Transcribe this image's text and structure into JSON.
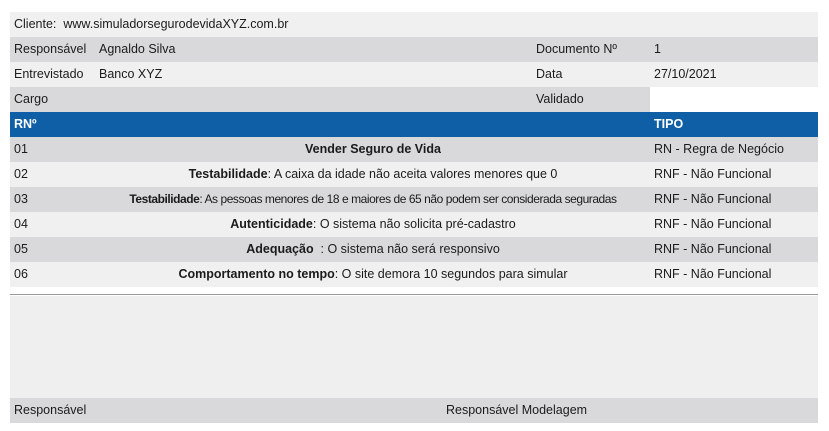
{
  "client": {
    "label": "Cliente:",
    "value": "www.simuladorsegurodevidaXYZ.com.br"
  },
  "info": [
    {
      "l1": "Responsável",
      "v1": "Agnaldo Silva",
      "l2": "Documento Nº",
      "v2": "1"
    },
    {
      "l1": "Entrevistado",
      "v1": "Banco XYZ",
      "l2": "Data",
      "v2": "27/10/2021"
    },
    {
      "l1": "Cargo",
      "v1": "",
      "l2": "Validado",
      "v2": ""
    }
  ],
  "header": {
    "rn": "RNº",
    "tipo": "TIPO"
  },
  "requirements": [
    {
      "rn": "01",
      "bold": "Vender Seguro de Vida",
      "text": "",
      "tipo": "RN - Regra de Negócio"
    },
    {
      "rn": "02",
      "bold": "Testabilidade",
      "text": ": A caixa da idade não aceita valores menores que 0",
      "tipo": "RNF - Não Funcional"
    },
    {
      "rn": "03",
      "bold": "Testabilidade",
      "text": ": As pessoas menores de 18 e maiores de 65 não podem ser considerada seguradas",
      "tipo": "RNF - Não Funcional"
    },
    {
      "rn": "04",
      "bold": "Autenticidade",
      "text": ": O sistema não solicita pré-cadastro",
      "tipo": "RNF - Não Funcional"
    },
    {
      "rn": "05",
      "bold": "Adequação",
      "text": "  : O sistema não será responsivo",
      "tipo": "RNF - Não Funcional"
    },
    {
      "rn": "06",
      "bold": "Comportamento no tempo",
      "text": ": O site demora 10 segundos para simular",
      "tipo": "RNF - Não Funcional"
    }
  ],
  "footer": {
    "left": "Responsável",
    "right": "Responsável Modelagem"
  }
}
